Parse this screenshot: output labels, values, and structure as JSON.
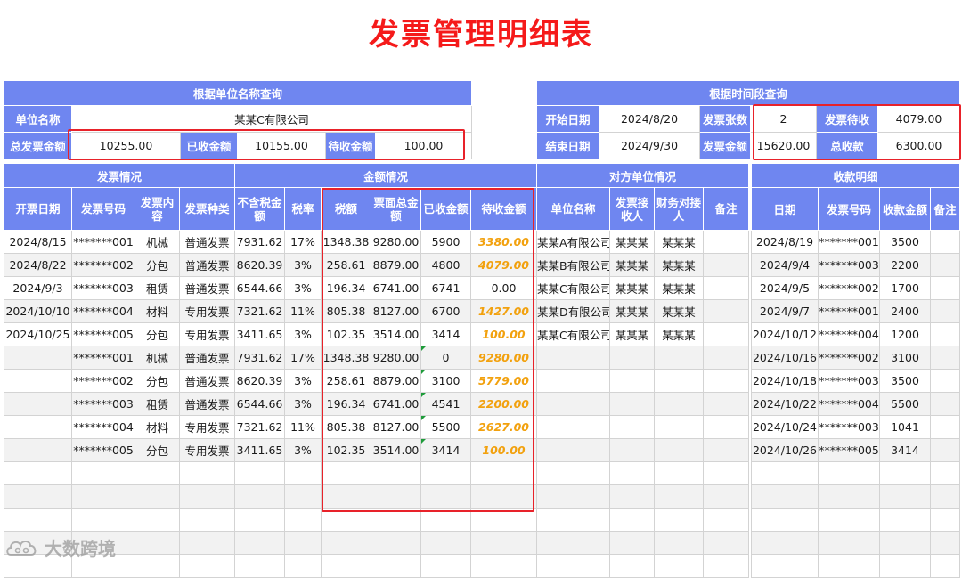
{
  "title": "发票管理明细表",
  "query_by_unit": {
    "header": "根据单位名称查询",
    "unit_label": "单位名称",
    "unit_value": "某某C有限公司",
    "total_label": "总发票金额",
    "total_value": "10255.00",
    "received_label": "已收金额",
    "received_value": "10155.00",
    "pending_label": "待收金额",
    "pending_value": "100.00"
  },
  "query_by_period": {
    "header": "根据时间段查询",
    "start_label": "开始日期",
    "start_value": "2024/8/20",
    "count_label": "发票张数",
    "count_value": "2",
    "pending_label": "发票待收",
    "pending_value": "4079.00",
    "end_label": "结束日期",
    "end_value": "2024/9/30",
    "amount_label": "发票金额",
    "amount_value": "15620.00",
    "total_received_label": "总收款",
    "total_received_value": "6300.00"
  },
  "sections": {
    "invoice": "发票情况",
    "amount": "金额情况",
    "counterparty": "对方单位情况",
    "receipts": "收款明细"
  },
  "columns": {
    "date": "开票日期",
    "invoice_no": "发票号码",
    "content": "发票内容",
    "type": "发票种类",
    "net": "不含税金额",
    "rate": "税率",
    "tax": "税额",
    "face": "票面总金额",
    "received": "已收金额",
    "pending": "待收金额",
    "unit": "单位名称",
    "recipient": "发票接收人",
    "contact": "财务对接人",
    "note": "备注",
    "r_date": "日期",
    "r_invoice_no": "发票号码",
    "r_amount": "收款金额",
    "r_note": "备注"
  },
  "invoice_rows": [
    {
      "date": "2024/8/15",
      "no": "*******001",
      "content": "机械",
      "type": "普通发票",
      "net": "7931.62",
      "rate": "17%",
      "tax": "1348.38",
      "face": "9280.00",
      "received": "5900",
      "pending": "3380.00",
      "unit": "某某A有限公司",
      "recipient": "某某某",
      "contact": "某某某",
      "note": ""
    },
    {
      "date": "2024/8/22",
      "no": "*******002",
      "content": "分包",
      "type": "普通发票",
      "net": "8620.39",
      "rate": "3%",
      "tax": "258.61",
      "face": "8879.00",
      "received": "4800",
      "pending": "4079.00",
      "unit": "某某B有限公司",
      "recipient": "某某某",
      "contact": "某某某",
      "note": ""
    },
    {
      "date": "2024/9/3",
      "no": "*******003",
      "content": "租赁",
      "type": "普通发票",
      "net": "6544.66",
      "rate": "3%",
      "tax": "196.34",
      "face": "6741.00",
      "received": "6741",
      "pending": "0.00",
      "unit": "某某C有限公司",
      "recipient": "某某某",
      "contact": "某某某",
      "note": ""
    },
    {
      "date": "2024/10/10",
      "no": "*******004",
      "content": "材料",
      "type": "专用发票",
      "net": "7321.62",
      "rate": "11%",
      "tax": "805.38",
      "face": "8127.00",
      "received": "6700",
      "pending": "1427.00",
      "unit": "某某D有限公司",
      "recipient": "某某某",
      "contact": "某某某",
      "note": ""
    },
    {
      "date": "2024/10/25",
      "no": "*******005",
      "content": "分包",
      "type": "专用发票",
      "net": "3411.65",
      "rate": "3%",
      "tax": "102.35",
      "face": "3514.00",
      "received": "3414",
      "pending": "100.00",
      "unit": "某某C有限公司",
      "recipient": "某某某",
      "contact": "某某某",
      "note": ""
    },
    {
      "date": "",
      "no": "*******001",
      "content": "机械",
      "type": "普通发票",
      "net": "7931.62",
      "rate": "17%",
      "tax": "1348.38",
      "face": "9280.00",
      "received": "0",
      "pending": "9280.00",
      "unit": "",
      "recipient": "",
      "contact": "",
      "note": ""
    },
    {
      "date": "",
      "no": "*******002",
      "content": "分包",
      "type": "普通发票",
      "net": "8620.39",
      "rate": "3%",
      "tax": "258.61",
      "face": "8879.00",
      "received": "3100",
      "pending": "5779.00",
      "unit": "",
      "recipient": "",
      "contact": "",
      "note": ""
    },
    {
      "date": "",
      "no": "*******003",
      "content": "租赁",
      "type": "普通发票",
      "net": "6544.66",
      "rate": "3%",
      "tax": "196.34",
      "face": "6741.00",
      "received": "4541",
      "pending": "2200.00",
      "unit": "",
      "recipient": "",
      "contact": "",
      "note": ""
    },
    {
      "date": "",
      "no": "*******004",
      "content": "材料",
      "type": "专用发票",
      "net": "7321.62",
      "rate": "11%",
      "tax": "805.38",
      "face": "8127.00",
      "received": "5500",
      "pending": "2627.00",
      "unit": "",
      "recipient": "",
      "contact": "",
      "note": ""
    },
    {
      "date": "",
      "no": "*******005",
      "content": "分包",
      "type": "专用发票",
      "net": "3411.65",
      "rate": "3%",
      "tax": "102.35",
      "face": "3514.00",
      "received": "3414",
      "pending": "100.00",
      "unit": "",
      "recipient": "",
      "contact": "",
      "note": ""
    }
  ],
  "receipt_rows": [
    {
      "date": "2024/8/19",
      "no": "*******001",
      "amount": "3500",
      "note": ""
    },
    {
      "date": "2024/9/4",
      "no": "*******003",
      "amount": "2200",
      "note": ""
    },
    {
      "date": "2024/9/5",
      "no": "*******002",
      "amount": "1700",
      "note": ""
    },
    {
      "date": "2024/9/7",
      "no": "*******001",
      "amount": "2400",
      "note": ""
    },
    {
      "date": "2024/10/12",
      "no": "*******004",
      "amount": "1200",
      "note": ""
    },
    {
      "date": "2024/10/16",
      "no": "*******002",
      "amount": "3100",
      "note": ""
    },
    {
      "date": "2024/10/18",
      "no": "*******003",
      "amount": "3500",
      "note": ""
    },
    {
      "date": "2024/10/22",
      "no": "*******004",
      "amount": "5500",
      "note": ""
    },
    {
      "date": "2024/10/24",
      "no": "*******003",
      "amount": "1041",
      "note": ""
    },
    {
      "date": "2024/10/26",
      "no": "*******005",
      "amount": "3414",
      "note": ""
    }
  ],
  "empty_rows": 5,
  "colors": {
    "header": "#6f86f0",
    "title": "#f51a1a",
    "pending": "#f2a10e",
    "highlight": "#e8222a"
  },
  "watermark": {
    "text": "大数跨境",
    "logo_icon": "cloud-logo-icon"
  }
}
